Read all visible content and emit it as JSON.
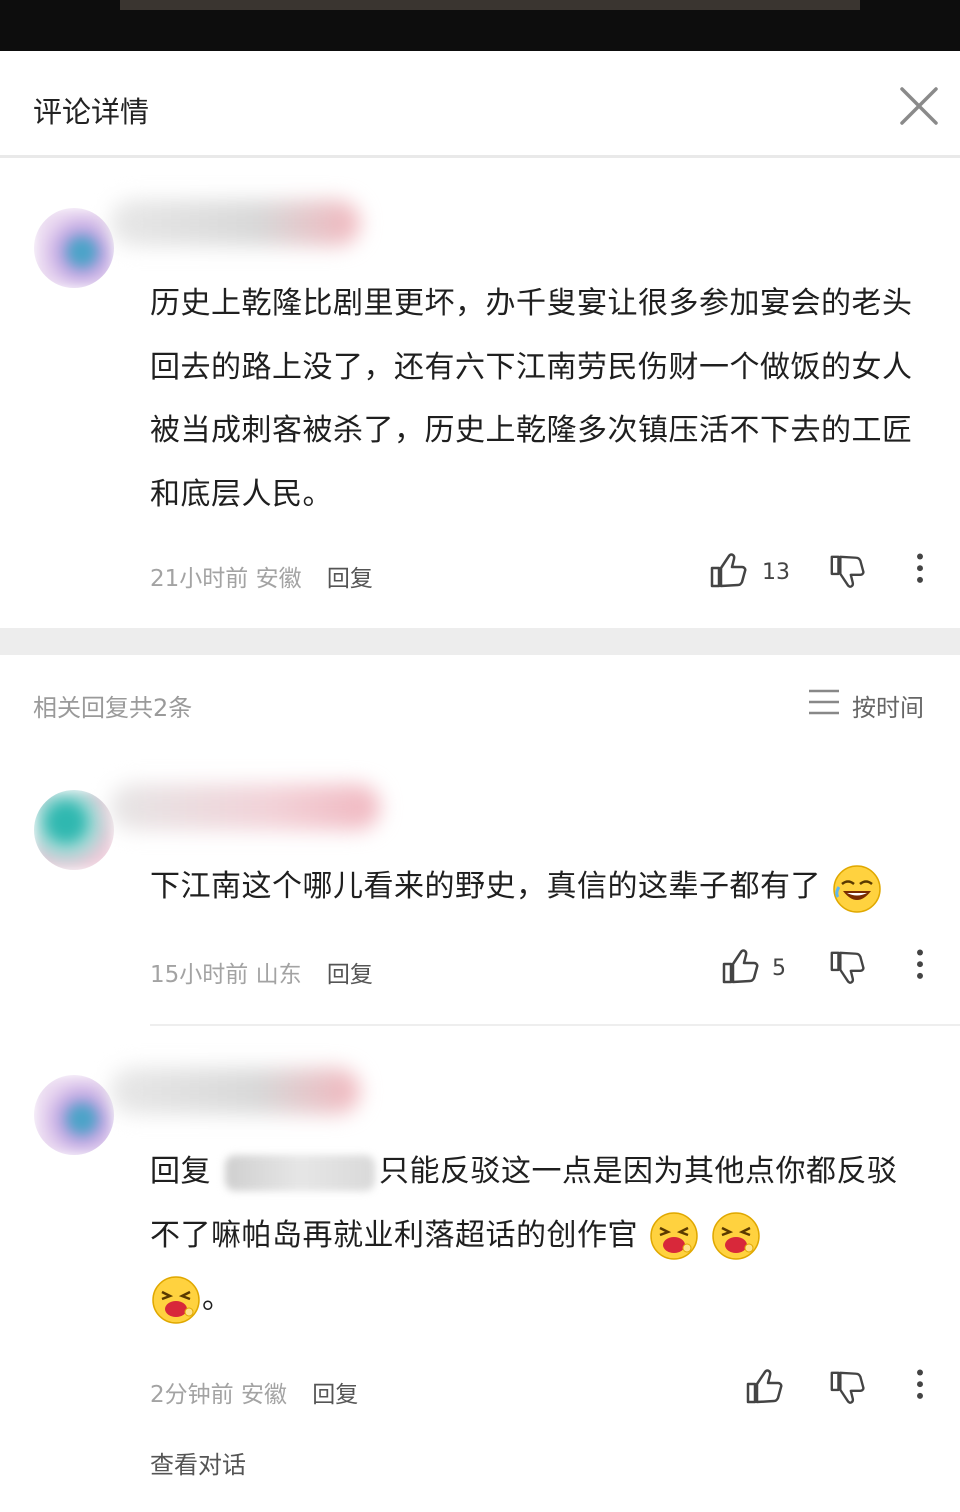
{
  "header": {
    "title": "评论详情"
  },
  "main_comment": {
    "text": "历史上乾隆比剧里更坏，办千叟宴让很多参加宴会的老头回去的路上没了，还有六下江南劳民伤财一个做饭的女人被当成刺客被杀了，历史上乾隆多次镇压活不下去的工匠和底层人民。",
    "time": "21小时前",
    "location": "安徽",
    "reply_label": "回复",
    "likes": "13"
  },
  "related": {
    "title": "相关回复共2条",
    "sort_label": "按时间"
  },
  "replies": [
    {
      "text": "下江南这个哪儿看来的野史，真信的这辈子都有了",
      "emojis": [
        "laughing-crying-emoji"
      ],
      "time": "15小时前",
      "location": "山东",
      "reply_label": "回复",
      "likes": "5"
    },
    {
      "reply_prefix": "回复",
      "text": "只能反驳这一点是因为其他点你都反驳不了嘛帕岛再就业利落超话的创作官",
      "emojis": [
        "drooling-face-emoji",
        "drooling-face-emoji",
        "drooling-face-emoji"
      ],
      "suffix": "。",
      "time": "2分钟前",
      "location": "安徽",
      "reply_label": "回复",
      "likes": ""
    }
  ],
  "footer": {
    "view_dialog": "查看对话"
  },
  "icons": [
    "close-icon",
    "thumbs-up-icon",
    "thumbs-down-icon",
    "more-vertical-icon",
    "sort-lines-icon"
  ],
  "colors": {
    "meta_gray": "#a3a3a3",
    "section_bg": "#ededed",
    "text": "#1f1f1f"
  }
}
